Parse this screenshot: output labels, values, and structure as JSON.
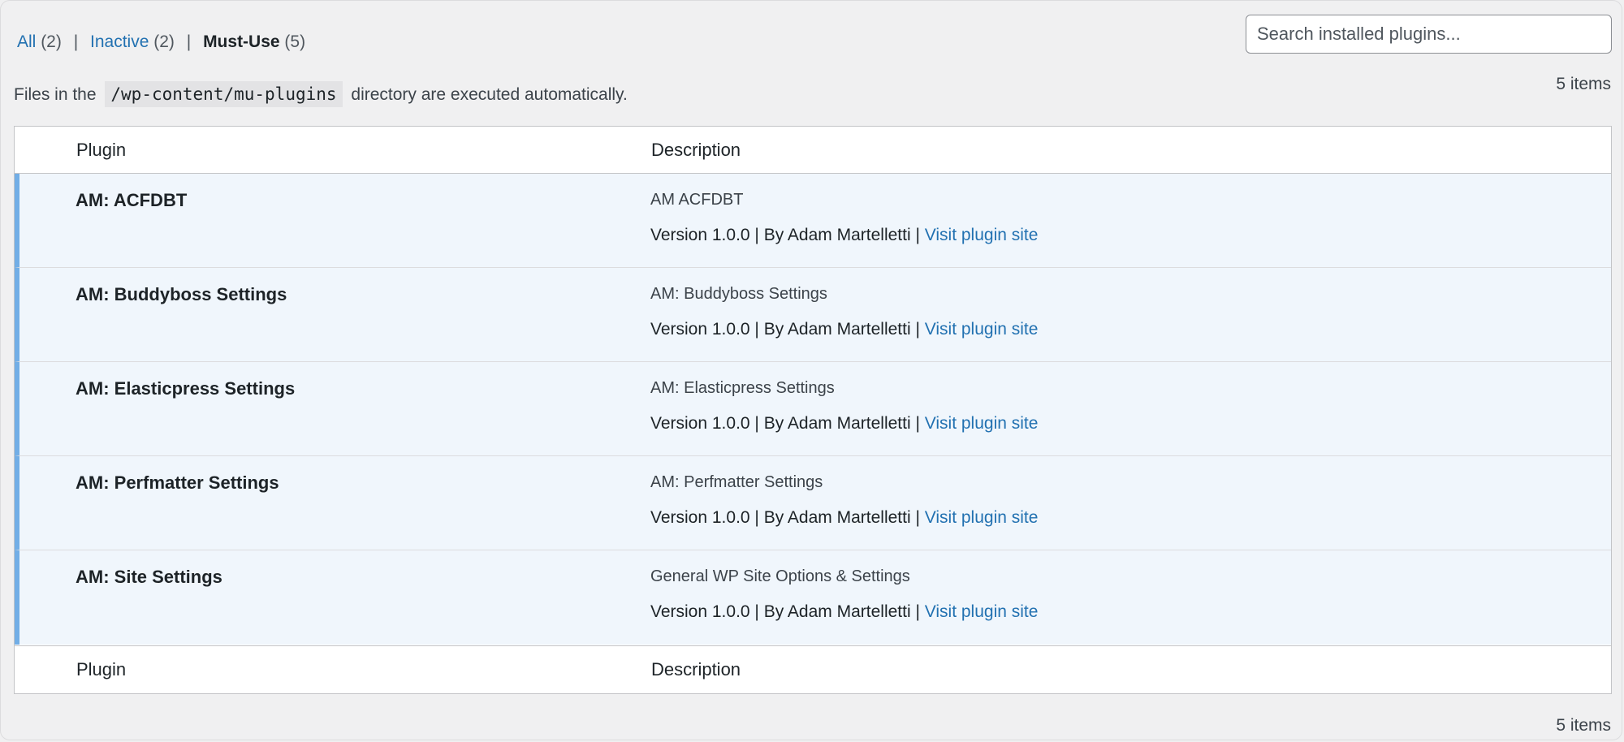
{
  "filters": {
    "all_label": "All",
    "all_count": "(2)",
    "inactive_label": "Inactive",
    "inactive_count": "(2)",
    "mustuse_label": "Must-Use",
    "mustuse_count": "(5)",
    "separator": "|"
  },
  "search": {
    "placeholder": "Search installed plugins..."
  },
  "item_count": "5 items",
  "notice": {
    "before": "Files in the",
    "path": "/wp-content/mu-plugins",
    "after": "directory are executed automatically."
  },
  "table": {
    "col_plugin": "Plugin",
    "col_description": "Description",
    "rows": [
      {
        "name": "AM: ACFDBT",
        "description": "AM ACFDBT",
        "version": "Version 1.0.0",
        "author": "By Adam Martelletti",
        "link": "Visit plugin site"
      },
      {
        "name": "AM: Buddyboss Settings",
        "description": "AM: Buddyboss Settings",
        "version": "Version 1.0.0",
        "author": "By Adam Martelletti",
        "link": "Visit plugin site"
      },
      {
        "name": "AM: Elasticpress Settings",
        "description": "AM: Elasticpress Settings",
        "version": "Version 1.0.0",
        "author": "By Adam Martelletti",
        "link": "Visit plugin site"
      },
      {
        "name": "AM: Perfmatter Settings",
        "description": "AM: Perfmatter Settings",
        "version": "Version 1.0.0",
        "author": "By Adam Martelletti",
        "link": "Visit plugin site"
      },
      {
        "name": "AM: Site Settings",
        "description": "General WP Site Options & Settings",
        "version": "Version 1.0.0",
        "author": "By Adam Martelletti",
        "link": "Visit plugin site"
      }
    ]
  },
  "colors": {
    "link": "#2271b1",
    "active_row_bg": "#f0f6fc",
    "active_row_border": "#72aee6"
  }
}
